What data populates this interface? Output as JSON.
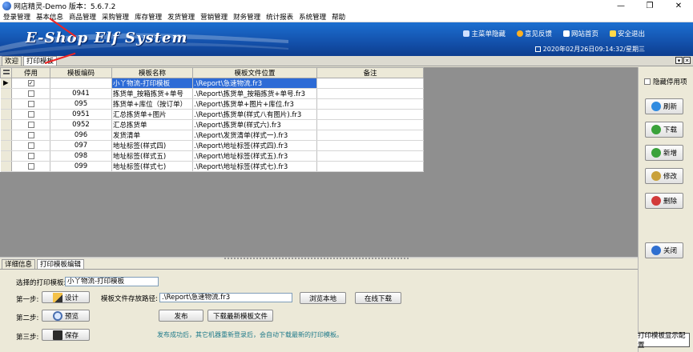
{
  "window": {
    "title": "网店精灵-Demo  版本：5.6.7.2",
    "controls": [
      "—",
      "❐",
      "✕"
    ]
  },
  "menu": [
    "登录管理",
    "基本信息",
    "商品管理",
    "采购管理",
    "库存管理",
    "发货管理",
    "营销管理",
    "财务管理",
    "统计报表",
    "系统管理",
    "帮助"
  ],
  "banner": {
    "brand": "E-Shop Elf System",
    "links": [
      {
        "label": "主菜单隐藏",
        "icon": "menu-icon",
        "color": "#cfe0ff"
      },
      {
        "label": "意见反馈",
        "icon": "feedback-icon",
        "color": "#ffb020"
      },
      {
        "label": "网站首页",
        "icon": "home-icon",
        "color": "#ffffff"
      },
      {
        "label": "安全退出",
        "icon": "lock-icon",
        "color": "#ffd84a"
      }
    ],
    "datetime": "2020年02月26日09:14:32/星期三"
  },
  "tabs": [
    "欢迎",
    "打印模板"
  ],
  "tab_controls": [
    "▾",
    "✕"
  ],
  "grid": {
    "columns": [
      "停用",
      "模板编码",
      "模板名称",
      "模板文件位置",
      "备注"
    ],
    "rows": [
      {
        "disabled": true,
        "code": "",
        "name": "小丫物流-打印模板",
        "path": ".\\Report\\急速物流.fr3",
        "note": ""
      },
      {
        "disabled": false,
        "code": "0941",
        "name": "拣货单_按箱拣货+单号",
        "path": ".\\Report\\拣货单_按箱拣货+单号.fr3",
        "note": ""
      },
      {
        "disabled": false,
        "code": "095",
        "name": "拣货单+库位（按订单）",
        "path": ".\\Report\\拣货单+图片+库位.fr3",
        "note": ""
      },
      {
        "disabled": false,
        "code": "0951",
        "name": "汇总拣货单+图片",
        "path": ".\\Report\\拣货单(样式八有图片).fr3",
        "note": ""
      },
      {
        "disabled": false,
        "code": "0952",
        "name": "汇总拣货单",
        "path": ".\\Report\\拣货单(样式六).fr3",
        "note": ""
      },
      {
        "disabled": false,
        "code": "096",
        "name": "发货清单",
        "path": ".\\Report\\发货清单(样式一).fr3",
        "note": ""
      },
      {
        "disabled": false,
        "code": "097",
        "name": "地址标签(样式四)",
        "path": ".\\Report\\地址标签(样式四).fr3",
        "note": ""
      },
      {
        "disabled": false,
        "code": "098",
        "name": "地址标签(样式五)",
        "path": ".\\Report\\地址标签(样式五).fr3",
        "note": ""
      },
      {
        "disabled": false,
        "code": "099",
        "name": "地址标签(样式七)",
        "path": ".\\Report\\地址标签(样式七).fr3",
        "note": ""
      }
    ]
  },
  "side": {
    "hide_disabled": "隐藏停用项",
    "buttons": [
      {
        "label": "刷新",
        "icon": "refresh-icon",
        "color": "#2f8be0"
      },
      {
        "label": "下载",
        "icon": "download-icon",
        "color": "#3aa23a"
      },
      {
        "label": "新增",
        "icon": "add-icon",
        "color": "#3aa23a"
      },
      {
        "label": "修改",
        "icon": "edit-icon",
        "color": "#c9a13a"
      },
      {
        "label": "删除",
        "icon": "delete-icon",
        "color": "#d23a3a"
      },
      {
        "label": "关闭",
        "icon": "power-icon",
        "color": "#2f6fd0"
      }
    ],
    "config_button": "打印模板显示配置"
  },
  "bottom_tabs": [
    "详细信息",
    "打印模板编辑"
  ],
  "editor": {
    "select_label": "选择的打印模板:",
    "select_value": "小丫物流-打印模板",
    "step1": "第一步:",
    "step2": "第二步:",
    "step3": "第三步:",
    "design": "设计",
    "preview": "预览",
    "save": "保存",
    "path_label": "模板文件存放路径:",
    "path_value": ".\\Report\\急速物流.fr3",
    "browse": "浏览本地",
    "online": "在线下载",
    "publish": "发布",
    "download_latest": "下载最新模板文件",
    "hint": "发布成功后，其它机器重新登录后，会自动下载最新的打印模板。"
  }
}
